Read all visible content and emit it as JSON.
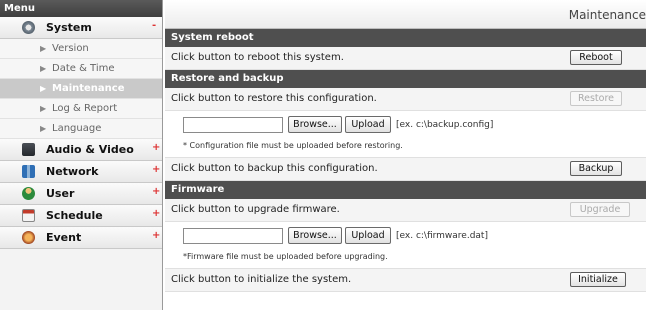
{
  "menu": {
    "header": "Menu",
    "categories": [
      {
        "label": "System",
        "icon": "gear-icon",
        "mark": "-"
      },
      {
        "label": "Audio & Video",
        "icon": "camera-icon",
        "mark": "+"
      },
      {
        "label": "Network",
        "icon": "network-icon",
        "mark": "+"
      },
      {
        "label": "User",
        "icon": "user-icon",
        "mark": "+"
      },
      {
        "label": "Schedule",
        "icon": "calendar-icon",
        "mark": "+"
      },
      {
        "label": "Event",
        "icon": "event-icon",
        "mark": "+"
      }
    ],
    "system_items": [
      "Version",
      "Date & Time",
      "Maintenance",
      "Log & Report",
      "Language"
    ],
    "active_item": "Maintenance"
  },
  "page": {
    "title": "Maintenance"
  },
  "reboot": {
    "heading": "System reboot",
    "text": "Click button to reboot this system.",
    "button": "Reboot"
  },
  "restore": {
    "heading": "Restore and backup",
    "text": "Click button to restore this configuration.",
    "restore_button": "Restore",
    "browse_button": "Browse...",
    "upload_button": "Upload",
    "example": "[ex. c:\\backup.config]",
    "note": "* Configuration file must be uploaded before restoring.",
    "backup_text": "Click button to backup this configuration.",
    "backup_button": "Backup"
  },
  "firmware": {
    "heading": "Firmware",
    "text": "Click button to upgrade firmware.",
    "upgrade_button": "Upgrade",
    "browse_button": "Browse...",
    "upload_button": "Upload",
    "example": "[ex. c:\\firmware.dat]",
    "note": "*Firmware file must be uploaded before upgrading.",
    "init_text": "Click button to initialize the system.",
    "init_button": "Initialize"
  },
  "colors": {
    "section_header": "#4f4f4f",
    "active_menu": "#c9c9c9",
    "expand_mark": "#dd3333"
  }
}
